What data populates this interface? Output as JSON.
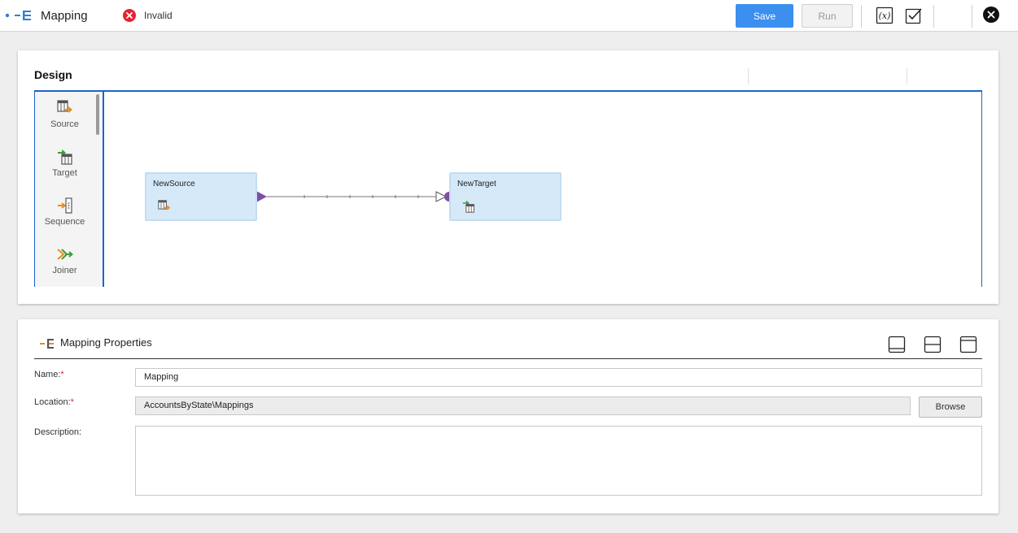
{
  "header": {
    "title": "Mapping",
    "status": "Invalid",
    "save_label": "Save",
    "run_label": "Run"
  },
  "design": {
    "title": "Design",
    "palette": [
      {
        "label": "Source",
        "icon": "source-icon"
      },
      {
        "label": "Target",
        "icon": "target-icon"
      },
      {
        "label": "Sequence",
        "icon": "sequence-icon"
      },
      {
        "label": "Joiner",
        "icon": "joiner-icon"
      }
    ],
    "nodes": [
      {
        "label": "NewSource",
        "icon": "source-icon"
      },
      {
        "label": "NewTarget",
        "icon": "target-icon"
      }
    ]
  },
  "properties": {
    "title": "Mapping Properties",
    "name_label": "Name:",
    "name_value": "Mapping",
    "location_label": "Location:",
    "location_value": "AccountsByState\\Mappings",
    "browse_label": "Browse",
    "description_label": "Description:",
    "description_value": "",
    "required_mark": "*"
  },
  "colors": {
    "accent": "#3b8fef",
    "error": "#e5242e",
    "node_fill": "#d6e9f8",
    "connector": "#7b4fa3"
  }
}
